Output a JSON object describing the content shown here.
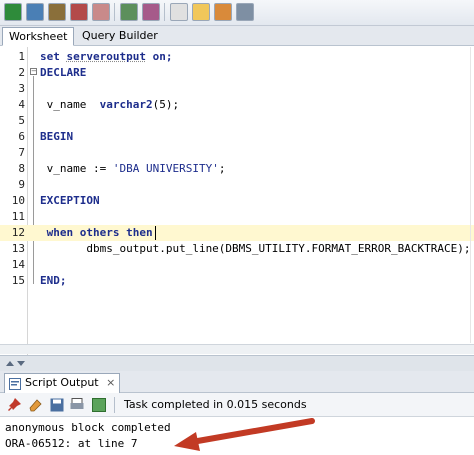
{
  "toolbar": {
    "icons": [
      "run-statement-icon",
      "run-script-icon",
      "commit-icon",
      "rollback-icon",
      "autotrace-icon",
      "explain-plan-icon",
      "sql-tuning-icon",
      "format-icon",
      "clear-icon",
      "history-icon"
    ]
  },
  "tabs": [
    {
      "label": "Worksheet"
    },
    {
      "label": "Query Builder"
    }
  ],
  "editor": {
    "lines": [
      {
        "n": "1",
        "tokens": [
          {
            "t": "set serveroutput on;",
            "c": "kw-mix"
          }
        ]
      },
      {
        "n": "2",
        "tokens": [
          {
            "t": "DECLARE",
            "c": "kw"
          }
        ]
      },
      {
        "n": "3",
        "tokens": []
      },
      {
        "n": "4",
        "tokens": [
          {
            "t": " v_name  varchar2(5);",
            "c": "decl"
          }
        ]
      },
      {
        "n": "5",
        "tokens": []
      },
      {
        "n": "6",
        "tokens": [
          {
            "t": "BEGIN",
            "c": "kw"
          }
        ]
      },
      {
        "n": "7",
        "tokens": []
      },
      {
        "n": "8",
        "tokens": [
          {
            "t": " v_name := 'DBA UNIVERSITY';",
            "c": "assign"
          }
        ]
      },
      {
        "n": "9",
        "tokens": []
      },
      {
        "n": "10",
        "tokens": [
          {
            "t": "EXCEPTION",
            "c": "kw"
          }
        ]
      },
      {
        "n": "11",
        "tokens": []
      },
      {
        "n": "12",
        "tokens": [
          {
            "t": " when others then",
            "c": "kw"
          }
        ]
      },
      {
        "n": "13",
        "tokens": [
          {
            "t": "       dbms_output.put_line(DBMS_UTILITY.FORMAT_ERROR_BACKTRACE);",
            "c": "txt"
          }
        ]
      },
      {
        "n": "14",
        "tokens": []
      },
      {
        "n": "15",
        "tokens": [
          {
            "t": "END;",
            "c": "kw"
          }
        ]
      }
    ],
    "line1": {
      "a": "set ",
      "b": "serveroutput",
      "c": " on;"
    },
    "line4": {
      "a": " v_name  ",
      "b": "varchar2",
      "c": "(5);"
    },
    "line8": {
      "a": " v_name := ",
      "b": "'DBA UNIVERSITY'",
      "c": ";"
    }
  },
  "output_panel": {
    "tab_label": "Script Output",
    "close_label": "×",
    "status": "Task completed in 0.015 seconds",
    "lines": [
      "anonymous block completed",
      "ORA-06512: at line 7"
    ]
  },
  "colors": {
    "keyword": "#1d2d8c",
    "arrow": "#c23a24"
  }
}
